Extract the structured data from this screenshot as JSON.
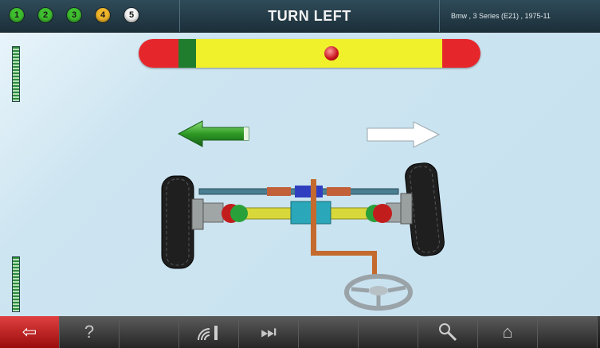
{
  "header": {
    "steps": [
      {
        "label": "1",
        "color": "#3fbf2f"
      },
      {
        "label": "2",
        "color": "#3fbf2f"
      },
      {
        "label": "3",
        "color": "#3fbf2f"
      },
      {
        "label": "4",
        "color": "#f0b62b"
      },
      {
        "label": "5",
        "color": "#f4f4f4"
      }
    ],
    "title": "TURN LEFT",
    "vehicle": "Bmw , 3 Series (E21) , 1975-11"
  },
  "gauge": {
    "zones": [
      "red",
      "green",
      "yellow",
      "red"
    ],
    "colors": {
      "red": "#e5272c",
      "green": "#1f7d2d",
      "yellow": "#f1f12b"
    },
    "indicator_position": 0.55
  },
  "direction": {
    "left_arrow": {
      "icon": "left-arrow-icon",
      "state": "active",
      "color": "#2e9a24"
    },
    "right_arrow": {
      "icon": "right-arrow-icon",
      "state": "inactive",
      "color": "#ffffff"
    }
  },
  "toolbar": {
    "buttons": [
      {
        "icon": "back-arrow-icon",
        "glyph": "⇦"
      },
      {
        "icon": "help-icon",
        "glyph": "?"
      },
      {
        "icon": "blank",
        "glyph": ""
      },
      {
        "icon": "signal-icon",
        "glyph": ""
      },
      {
        "icon": "fast-forward-icon",
        "glyph": "⏭"
      },
      {
        "icon": "blank",
        "glyph": ""
      },
      {
        "icon": "blank",
        "glyph": ""
      },
      {
        "icon": "tools-icon",
        "glyph": ""
      },
      {
        "icon": "home-icon",
        "glyph": "⌂"
      },
      {
        "icon": "blank",
        "glyph": ""
      }
    ]
  }
}
